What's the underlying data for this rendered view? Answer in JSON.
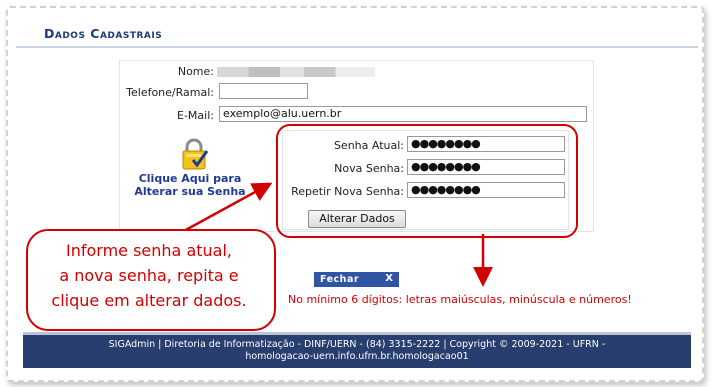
{
  "page": {
    "title": "Dados Cadastrais"
  },
  "form": {
    "name_label": "Nome:",
    "phone_label": "Telefone/Ramal:",
    "phone_value": "",
    "email_label": "E-Mail:",
    "email_value": "exemplo@alu.uern.br"
  },
  "password_link": {
    "label_line1": "Clique Aqui para",
    "label_line2": "Alterar sua Senha",
    "icon": "lock-icon"
  },
  "password_form": {
    "current_label": "Senha Atual:",
    "current_value": "●●●●●●●●",
    "new_label": "Nova Senha:",
    "new_value": "●●●●●●●●",
    "repeat_label": "Repetir Nova Senha:",
    "repeat_value": "●●●●●●●●",
    "submit_label": "Alterar Dados"
  },
  "callout": {
    "line1": "Informe senha atual,",
    "line2": "a nova senha, repita e",
    "line3": "clique em alterar dados."
  },
  "close_bar": {
    "label": "Fechar",
    "close_icon": "X"
  },
  "note": "No mínimo 6 dígitos: letras maiúsculas, minúscula e números!",
  "footer": {
    "line1": "SIGAdmin | Diretoria de Informatização - DINF/UERN - (84) 3315-2222 | Copyright © 2009-2021 - UFRN -",
    "line2": "homologacao-uern.info.ufrn.br.homologacao01"
  },
  "colors": {
    "accent": "#d20000",
    "brand": "#273e6e",
    "link": "#1f3a93"
  }
}
